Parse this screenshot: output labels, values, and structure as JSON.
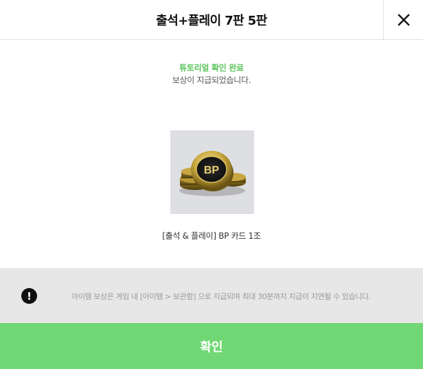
{
  "header": {
    "title": "출석+플레이 7판 5판",
    "close_icon": "close-icon"
  },
  "notice": {
    "status": "튜토리얼 확인 완료",
    "message": "보상이 지급되었습니다."
  },
  "reward": {
    "image_icon": "bp-coins-icon",
    "item_name": "[출석 & 플레이] BP 카드 1조",
    "coin_text": "BP"
  },
  "info": {
    "icon": "exclamation-icon",
    "icon_glyph": "!",
    "message": "아이템 보상은 게임 내 [아이템 > 보관함] 으로 지급되며 최대 30분까지 지급이 지연될 수 있습니다."
  },
  "footer": {
    "confirm_label": "확인"
  },
  "colors": {
    "accent_green": "#70d774",
    "status_green": "#5cc55e",
    "info_bg": "#e7e7e7",
    "thumb_bg": "#dedfe2"
  }
}
